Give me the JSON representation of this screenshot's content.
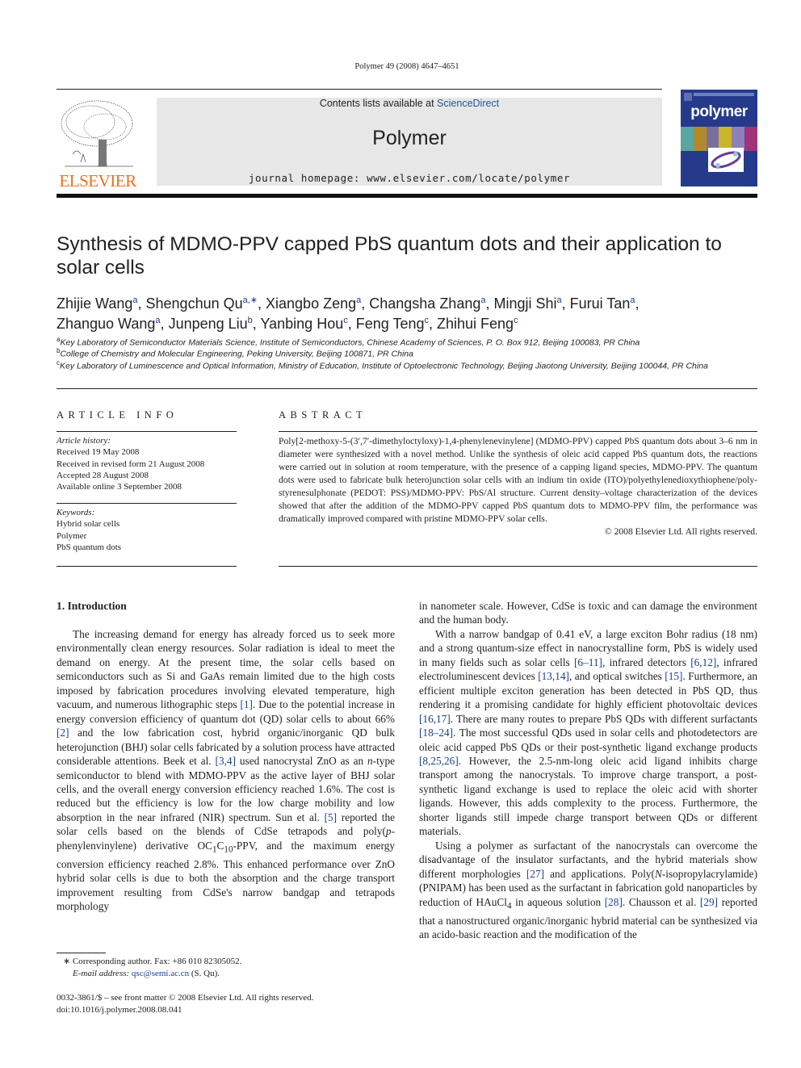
{
  "header": {
    "citation": "Polymer 49 (2008) 4647–4651",
    "contents_prefix": "Contents lists available at ",
    "contents_link": "ScienceDirect",
    "journal_title": "Polymer",
    "homepage": "journal homepage: www.elsevier.com/locate/polymer",
    "publisher": "ELSEVIER",
    "cover_word": "polymer",
    "colors": {
      "publisher_orange": "#ef6e1f",
      "cover_blue": "#253a8a",
      "link_blue": "#1a3f8a",
      "banner_gray": "#e7e7e7"
    }
  },
  "article": {
    "title": "Synthesis of MDMO-PPV capped PbS quantum dots and their application to solar cells",
    "authors": [
      {
        "name": "Zhijie Wang",
        "aff": "a"
      },
      {
        "name": "Shengchun Qu",
        "aff": "a,∗"
      },
      {
        "name": "Xiangbo Zeng",
        "aff": "a"
      },
      {
        "name": "Changsha Zhang",
        "aff": "a"
      },
      {
        "name": "Mingji Shi",
        "aff": "a"
      },
      {
        "name": "Furui Tan",
        "aff": "a"
      },
      {
        "name": "Zhanguo Wang",
        "aff": "a"
      },
      {
        "name": "Junpeng Liu",
        "aff": "b"
      },
      {
        "name": "Yanbing Hou",
        "aff": "c"
      },
      {
        "name": "Feng Teng",
        "aff": "c"
      },
      {
        "name": "Zhihui Feng",
        "aff": "c"
      }
    ],
    "affiliations": [
      {
        "key": "a",
        "text": "Key Laboratory of Semiconductor Materials Science, Institute of Semiconductors, Chinese Academy of Sciences, P. O. Box 912, Beijing 100083, PR China"
      },
      {
        "key": "b",
        "text": "College of Chemistry and Molecular Engineering, Peking University, Beijing 100871, PR China"
      },
      {
        "key": "c",
        "text": "Key Laboratory of Luminescence and Optical Information, Ministry of Education, Institute of Optoelectronic Technology, Beijing Jiaotong University, Beijing 100044, PR China"
      }
    ]
  },
  "article_info": {
    "heading": "ARTICLE INFO",
    "history_label": "Article history:",
    "history": [
      "Received 19 May 2008",
      "Received in revised form 21 August 2008",
      "Accepted 28 August 2008",
      "Available online 3 September 2008"
    ],
    "keywords_label": "Keywords:",
    "keywords": [
      "Hybrid solar cells",
      "Polymer",
      "PbS quantum dots"
    ]
  },
  "abstract": {
    "heading": "ABSTRACT",
    "text": "Poly[2-methoxy-5-(3′,7′-dimethyloctyloxy)-1,4-phenylenevinylene] (MDMO-PPV) capped PbS quantum dots about 3–6 nm in diameter were synthesized with a novel method. Unlike the synthesis of oleic acid capped PbS quantum dots, the reactions were carried out in solution at room temperature, with the presence of a capping ligand species, MDMO-PPV. The quantum dots were used to fabricate bulk heterojunction solar cells with an indium tin oxide (ITO)/polyethylenedioxythiophene/poly-styrenesulphonate (PEDOT: PSS)/MDMO-PPV: PbS/Al structure. Current density–voltage characterization of the devices showed that after the addition of the MDMO-PPV capped PbS quantum dots to MDMO-PPV film, the performance was dramatically improved compared with pristine MDMO-PPV solar cells.",
    "copyright": "© 2008 Elsevier Ltd. All rights reserved."
  },
  "body": {
    "section_heading": "1.  Introduction",
    "left_col": {
      "p1_a": "The increasing demand for energy has already forced us to seek more environmentally clean energy resources. Solar radiation is ideal to meet the demand on energy. At the present time, the solar cells based on semiconductors such as Si and GaAs remain limited due to the high costs imposed by fabrication procedures involving elevated temperature, high vacuum, and numerous lithographic steps ",
      "ref1": "[1]",
      "p1_b": ". Due to the potential increase in energy conversion efficiency of quantum dot (QD) solar cells to about 66% ",
      "ref2": "[2]",
      "p1_c": " and the low fabrication cost, hybrid organic/inorganic QD bulk heterojunction (BHJ) solar cells fabricated by a solution process have attracted considerable attentions. Beek et al. ",
      "ref3": "[3,4]",
      "p1_d": " used nanocrystal ZnO as an ",
      "italic_n": "n",
      "p1_e": "-type semiconductor to blend with MDMO-PPV as the active layer of BHJ solar cells, and the overall energy conversion efficiency reached 1.6%. The cost is reduced but the efficiency is low for the low charge mobility and low absorption in the near infrared (NIR) spectrum. Sun et al. ",
      "ref5": "[5]",
      "p1_f": " reported the solar cells based on the blends of CdSe tetrapods and poly(",
      "italic_p": "p",
      "p1_g": "-phenylenvinylene) derivative OC",
      "sub1": "1",
      "p1_h": "C",
      "sub10": "10",
      "p1_i": "-PPV, and the maximum energy conversion efficiency reached 2.8%. This enhanced performance over ZnO hybrid solar cells is due to both the absorption and the charge transport improvement resulting from CdSe's narrow bandgap and tetrapods morphology"
    },
    "right_col": {
      "p1_cont": "in nanometer scale. However, CdSe is toxic and can damage the environment and the human body.",
      "p2_a": "With a narrow bandgap of 0.41 eV, a large exciton Bohr radius (18 nm) and a strong quantum-size effect in nanocrystalline form, PbS is widely used in many fields such as solar cells ",
      "ref6": "[6–11]",
      "p2_b": ", infrared detectors ",
      "ref7": "[6,12]",
      "p2_c": ", infrared electroluminescent devices ",
      "ref8": "[13,14]",
      "p2_d": ", and optical switches ",
      "ref9": "[15]",
      "p2_e": ". Furthermore, an efficient multiple exciton generation has been detected in PbS QD, thus rendering it a promising candidate for highly efficient photovoltaic devices ",
      "ref10": "[16,17]",
      "p2_f": ". There are many routes to prepare PbS QDs with different surfactants ",
      "ref11": "[18–24]",
      "p2_g": ". The most successful QDs used in solar cells and photodetectors are oleic acid capped PbS QDs or their post-synthetic ligand exchange products ",
      "ref12": "[8,25,26]",
      "p2_h": ". However, the 2.5-nm-long oleic acid ligand inhibits charge transport among the nanocrystals. To improve charge transport, a post-synthetic ligand exchange is used to replace the oleic acid with shorter ligands. However, this adds complexity to the process. Furthermore, the shorter ligands still impede charge transport between QDs or different materials.",
      "p3_a": "Using a polymer as surfactant of the nanocrystals can overcome the disadvantage of the insulator surfactants, and the hybrid materials show different morphologies ",
      "ref13": "[27]",
      "p3_b": " and applications. Poly(",
      "italic_N": "N",
      "p3_c": "-isopropylacrylamide) (PNIPAM) has been used as the surfactant in fabrication gold nanoparticles by reduction of HAuCl",
      "sub4": "4",
      "p3_d": " in aqueous solution ",
      "ref14": "[28]",
      "p3_e": ". Chausson et al. ",
      "ref15": "[29]",
      "p3_f": " reported that a nanostructured organic/inorganic hybrid material can be synthesized via an acido-basic reaction and the modification of the"
    }
  },
  "footnotes": {
    "corresponding": "∗  Corresponding author. Fax: +86 010 82305052.",
    "email_label": "E-mail address: ",
    "email": "qsc@semi.ac.cn",
    "email_suffix": " (S. Qu).",
    "issn": "0032-3861/$ – see front matter © 2008 Elsevier Ltd. All rights reserved.",
    "doi": "doi:10.1016/j.polymer.2008.08.041"
  }
}
